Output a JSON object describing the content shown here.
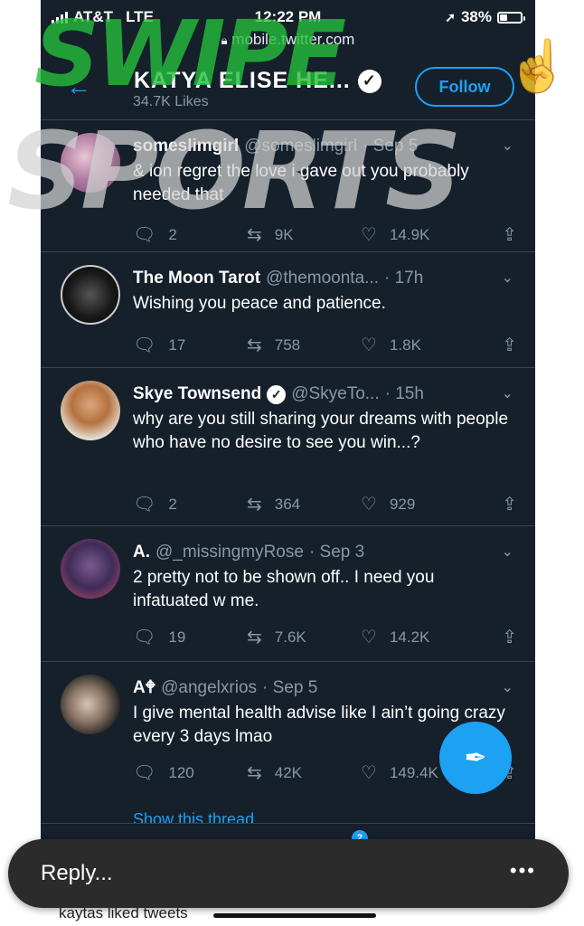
{
  "status_bar": {
    "carrier": "AT&T",
    "network": "LTE",
    "time": "12:22 PM",
    "battery": "38%",
    "battery_level": 0.38
  },
  "browser": {
    "url": "mobile.twitter.com"
  },
  "header": {
    "title": "KATYA ELISE HE...",
    "subtitle": "34.7K Likes",
    "follow_label": "Follow"
  },
  "tweets": [
    {
      "name": "someslimgirl",
      "handle": "@someslimgirl",
      "time": "· Sep 5",
      "verified": false,
      "text": "& ion regret the love i gave out you probably needed that",
      "replies": "2",
      "retweets": "9K",
      "likes": "14.9K"
    },
    {
      "name": "The Moon Tarot",
      "handle": "@themoonta...",
      "time": "· 17h",
      "verified": false,
      "text": "Wishing you peace and patience.",
      "replies": "17",
      "retweets": "758",
      "likes": "1.8K"
    },
    {
      "name": "Skye Townsend",
      "handle": "@SkyeTo...",
      "time": "· 15h",
      "verified": true,
      "text": "why are you still sharing your dreams with people who have no desire to see you win...?",
      "replies": "2",
      "retweets": "364",
      "likes": "929"
    },
    {
      "name": "A.",
      "handle": "@_missingmyRose",
      "time": "· Sep 3",
      "verified": false,
      "text": "2 pretty not to be shown off.. I need you infatuated w me.",
      "replies": "19",
      "retweets": "7.6K",
      "likes": "14.2K"
    },
    {
      "name": "A🕈",
      "handle": "@angelxrios",
      "time": "· Sep 5",
      "verified": false,
      "text": "I give mental health advise like I ain’t going crazy every 3 days lmao",
      "replies": "120",
      "retweets": "42K",
      "likes": "149.4K"
    }
  ],
  "show_thread": "Show this thread",
  "bottom_nav": {
    "notification_count": "2"
  },
  "reply_bar": {
    "label": "Reply...",
    "more": "•••"
  },
  "notification_text": "kaytas liked tweets",
  "watermark": {
    "line1": "SWIPE",
    "line2": "SPORTS"
  },
  "colors": {
    "background": "#15202b",
    "accent": "#1da1f2",
    "secondary_text": "#8899a6",
    "divider": "#38444d",
    "watermark_green": "#24be3c"
  },
  "icons": {
    "back": "arrow-left-icon",
    "lock": "lock-icon",
    "location": "location-arrow-icon",
    "reply": "reply-bubble-icon",
    "retweet": "retweet-icon",
    "like": "heart-icon",
    "share": "share-icon",
    "compose": "compose-feather-icon",
    "home": "home-icon",
    "search": "search-icon",
    "notifications": "bell-icon",
    "messages": "mail-icon"
  }
}
